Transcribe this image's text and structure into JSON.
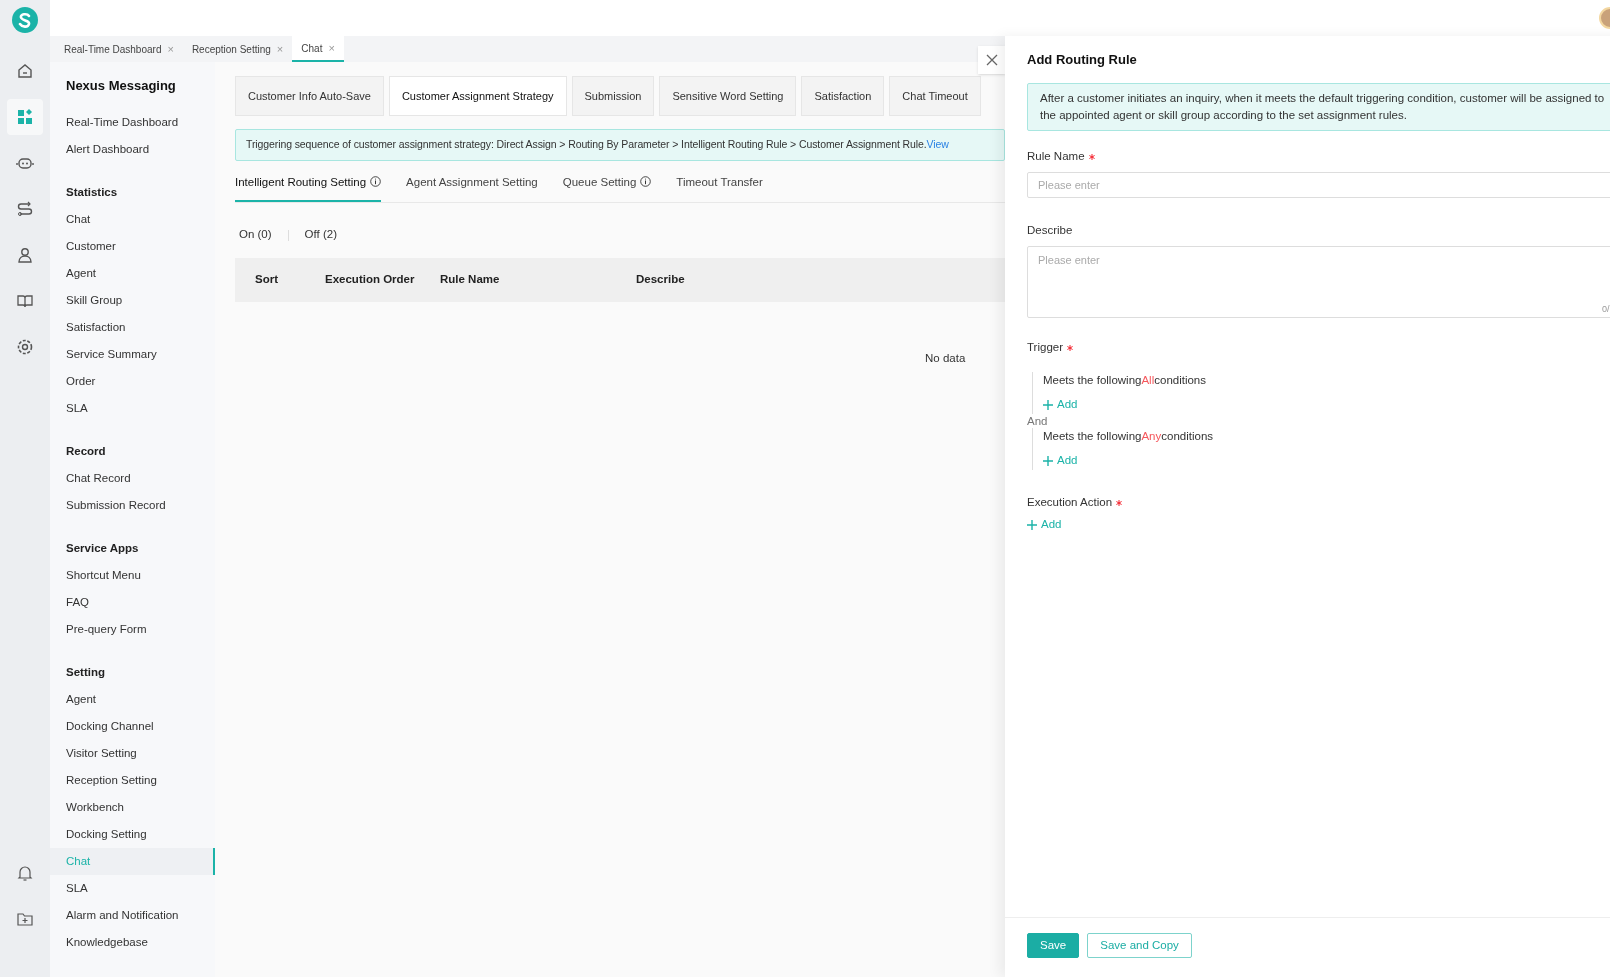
{
  "rail": {
    "items": [
      {
        "selected": false
      },
      {
        "selected": true
      },
      {
        "selected": false
      },
      {
        "selected": false
      },
      {
        "selected": false
      },
      {
        "selected": false
      },
      {
        "selected": false
      }
    ],
    "bottom": [
      {
        "selected": false
      },
      {
        "selected": false
      }
    ]
  },
  "app_tabs": [
    {
      "label": "Real-Time Dashboard",
      "close": "×",
      "selected": false
    },
    {
      "label": "Reception Setting",
      "close": "×",
      "selected": false
    },
    {
      "label": "Chat",
      "close": "×",
      "selected": true
    }
  ],
  "sidebar": {
    "title": "Nexus Messaging",
    "sections": [
      {
        "items": [
          {
            "label": "Real-Time Dashboard",
            "selected": false
          },
          {
            "label": "Alert Dashboard",
            "selected": false
          }
        ]
      },
      {
        "heading": "Statistics",
        "items": [
          {
            "label": "Chat",
            "selected": false
          },
          {
            "label": "Customer",
            "selected": false
          },
          {
            "label": "Agent",
            "selected": false
          },
          {
            "label": "Skill Group",
            "selected": false
          },
          {
            "label": "Satisfaction",
            "selected": false
          },
          {
            "label": "Service Summary",
            "selected": false
          },
          {
            "label": "Order",
            "selected": false
          },
          {
            "label": "SLA",
            "selected": false
          }
        ]
      },
      {
        "heading": "Record",
        "items": [
          {
            "label": "Chat Record",
            "selected": false
          },
          {
            "label": "Submission Record",
            "selected": false
          }
        ]
      },
      {
        "heading": "Service Apps",
        "items": [
          {
            "label": "Shortcut Menu",
            "selected": false
          },
          {
            "label": "FAQ",
            "selected": false
          },
          {
            "label": "Pre-query Form",
            "selected": false
          }
        ]
      },
      {
        "heading": "Setting",
        "items": [
          {
            "label": "Agent",
            "selected": false
          },
          {
            "label": "Docking Channel",
            "selected": false
          },
          {
            "label": "Visitor Setting",
            "selected": false
          },
          {
            "label": "Reception Setting",
            "selected": false
          },
          {
            "label": "Workbench",
            "selected": false
          },
          {
            "label": "Docking Setting",
            "selected": false
          },
          {
            "label": "Chat",
            "selected": true
          },
          {
            "label": "SLA",
            "selected": false
          },
          {
            "label": "Alarm and Notification",
            "selected": false
          },
          {
            "label": "Knowledgebase",
            "selected": false
          }
        ]
      }
    ]
  },
  "main": {
    "tabs": [
      {
        "label": "Customer Info Auto-Save",
        "selected": false
      },
      {
        "label": "Customer Assignment Strategy",
        "selected": true
      },
      {
        "label": "Submission",
        "selected": false
      },
      {
        "label": "Sensitive Word Setting",
        "selected": false
      },
      {
        "label": "Satisfaction",
        "selected": false
      },
      {
        "label": "Chat Timeout",
        "selected": false
      }
    ],
    "banner": {
      "text": "Triggering sequence of customer assignment strategy: Direct Assign > Routing By Parameter > Intelligent Routing Rule > Customer Assignment Rule.",
      "link": "View"
    },
    "subtabs": [
      {
        "label": "Intelligent Routing Setting",
        "info": true,
        "selected": true
      },
      {
        "label": "Agent Assignment Setting",
        "info": false,
        "selected": false
      },
      {
        "label": "Queue Setting",
        "info": true,
        "selected": false
      },
      {
        "label": "Timeout Transfer",
        "info": false,
        "selected": false
      }
    ],
    "filters": [
      {
        "label": "On (0)"
      },
      {
        "label": "Off (2)"
      }
    ],
    "table": {
      "columns": [
        "Sort",
        "Execution Order",
        "Rule Name",
        "Describe"
      ],
      "empty_text": "No data"
    }
  },
  "drawer": {
    "title": "Add Routing Rule",
    "info": "After a customer initiates an inquiry, when it meets the default triggering condition, customer will be assigned to the appointed agent or skill group according to the set assignment rules.",
    "rule_name": {
      "label": "Rule Name",
      "required": true,
      "placeholder": "Please enter"
    },
    "describe": {
      "label": "Describe",
      "required": false,
      "placeholder": "Please enter",
      "counter": "0/"
    },
    "trigger": {
      "label": "Trigger",
      "required": true,
      "groups": [
        {
          "prefix": "Meets the following",
          "keyword": "All",
          "suffix": "conditions",
          "add": "Add"
        },
        {
          "prefix": "Meets the following",
          "keyword": "Any",
          "suffix": "conditions",
          "add": "Add"
        }
      ],
      "joiner": "And"
    },
    "action": {
      "label": "Execution Action",
      "required": true,
      "add": "Add"
    },
    "buttons": [
      {
        "label": "Save",
        "kind": "primary"
      },
      {
        "label": "Save and Copy",
        "kind": "secondary"
      }
    ]
  }
}
